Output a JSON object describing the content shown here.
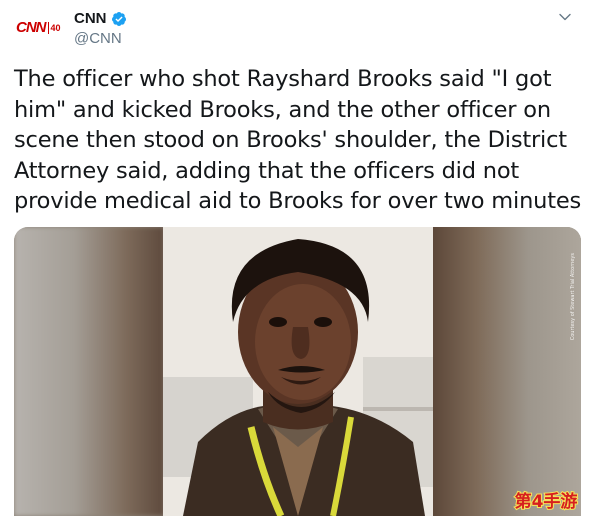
{
  "tweet": {
    "author": {
      "avatar_logo": "CNN",
      "avatar_badge": "40",
      "display_name": "CNN",
      "handle": "@CNN",
      "verified": true
    },
    "menu_icon": "chevron-down-icon",
    "text": "The officer who shot Rayshard Brooks said \"I got him\" and kicked Brooks, and the other officer on scene then stood on Brooks' shoulder, the District Attorney said, adding that the officers did not provide medical aid to Brooks for over two minutes",
    "media": {
      "photo_credit": "Courtesy of Stewart Trial Attorneys"
    }
  },
  "watermark": {
    "text": "第4手游"
  },
  "colors": {
    "brand_red": "#cc0000",
    "verified_blue": "#1da1f2",
    "text": "#14171a",
    "secondary_text": "#657786",
    "watermark_fill": "#d61f1f",
    "watermark_stroke": "#f7e45a"
  }
}
